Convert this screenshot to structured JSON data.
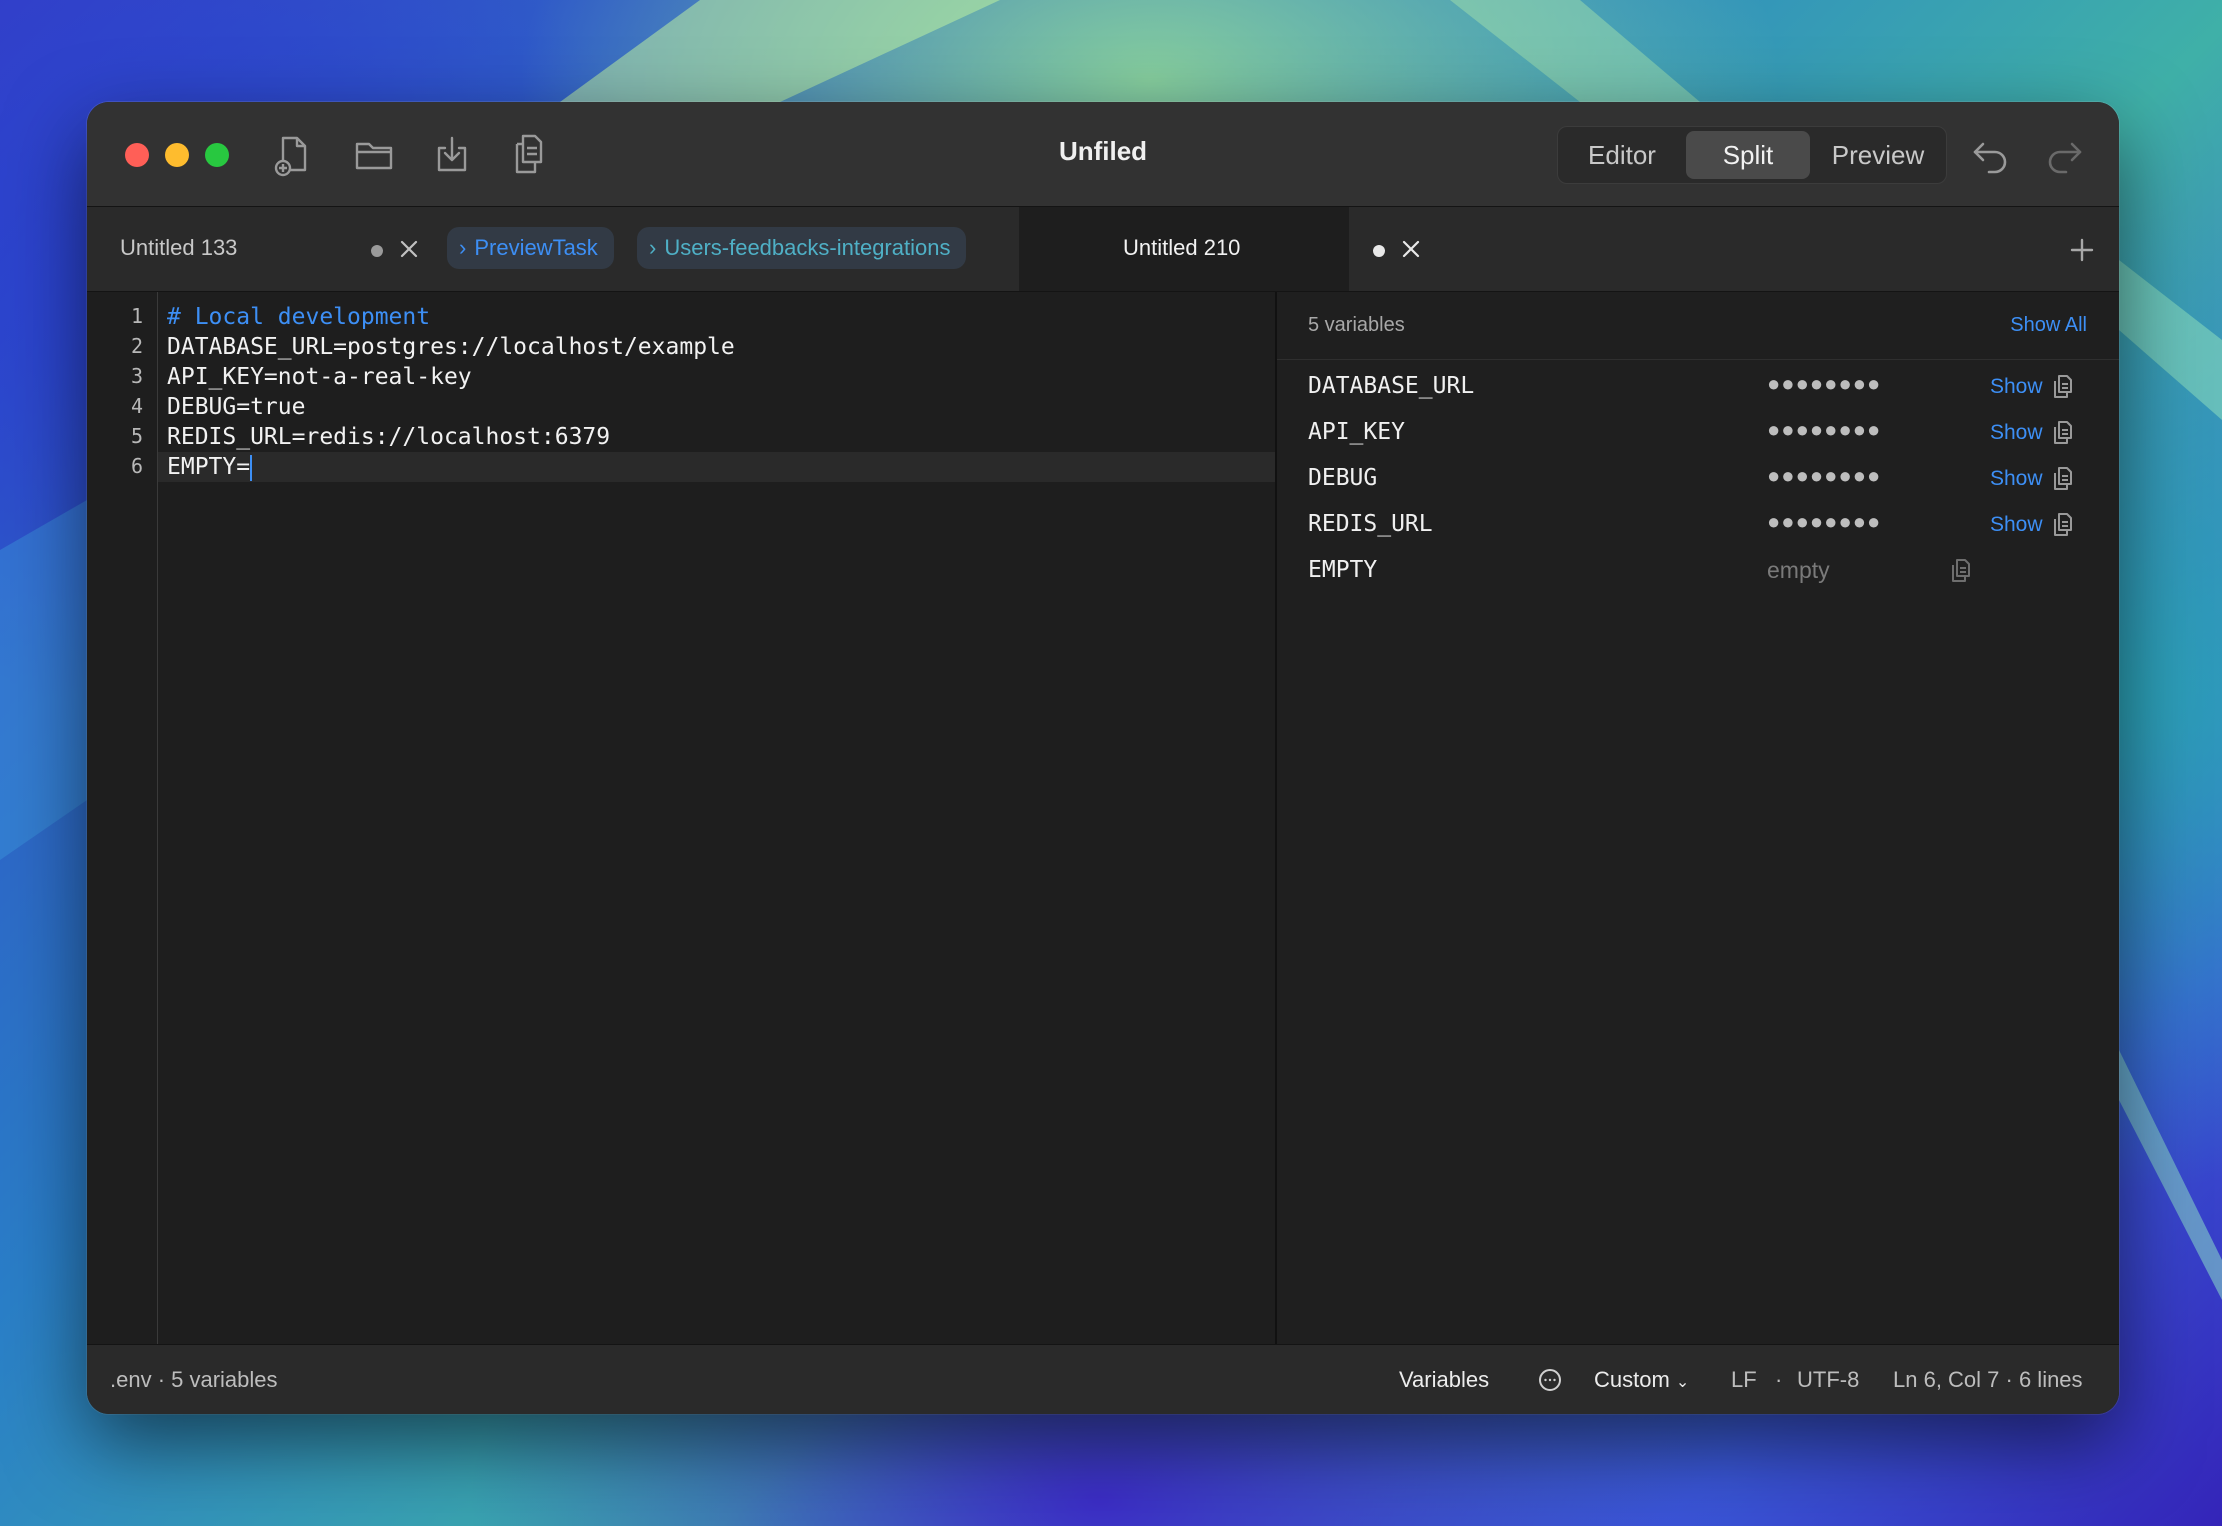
{
  "window": {
    "title": "Unfiled"
  },
  "toolbar": {
    "view_modes": [
      "Editor",
      "Split",
      "Preview"
    ],
    "active_view": "Split",
    "icons": [
      "new-file-icon",
      "open-folder-icon",
      "download-icon",
      "duplicate-icon",
      "undo-icon",
      "redo-icon"
    ]
  },
  "tabs": [
    {
      "title": "Untitled 133",
      "unsaved": true
    },
    {
      "title": "PreviewTask",
      "type": "crumb"
    },
    {
      "title": "Users-feedbacks-integrations",
      "type": "crumb"
    },
    {
      "title": "Untitled 210",
      "unsaved": true,
      "active": true
    }
  ],
  "editor": {
    "line_numbers": [
      "1",
      "2",
      "3",
      "4",
      "5",
      "6"
    ],
    "lines": [
      "# Local development",
      "DATABASE_URL=postgres://localhost/example",
      "API_KEY=not-a-real-key",
      "DEBUG=true",
      "REDIS_URL=redis://localhost:6379",
      "EMPTY="
    ]
  },
  "preview": {
    "count_label": "5 variables",
    "show_all_label": "Show All",
    "show_label": "Show",
    "mask": "●●●●●●●●",
    "empty_label": "empty",
    "variables": [
      {
        "name": "DATABASE_URL"
      },
      {
        "name": "API_KEY"
      },
      {
        "name": "DEBUG"
      },
      {
        "name": "REDIS_URL"
      },
      {
        "name": "EMPTY"
      }
    ]
  },
  "statusbar": {
    "file_info": ".env · 5 variables",
    "variables_label": "Variables",
    "theme_label": "Custom",
    "line_ending": "LF",
    "separator": "·",
    "encoding": "UTF-8",
    "position": "Ln 6, Col 7 · 6 lines"
  },
  "colors": {
    "accent": "#3d8ff5",
    "background": "#1e1e1e"
  }
}
